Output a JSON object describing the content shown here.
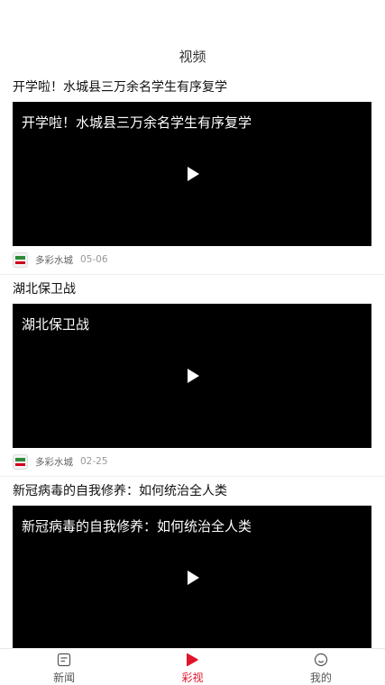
{
  "header": {
    "title": "视频"
  },
  "feed": [
    {
      "title": "开学啦！水城县三万余名学生有序复学",
      "caption": "开学啦！水城县三万余名学生有序复学",
      "source": "多彩水城",
      "date": "05-06"
    },
    {
      "title": "湖北保卫战",
      "caption": "湖北保卫战",
      "source": "多彩水城",
      "date": "02-25"
    },
    {
      "title": "新冠病毒的自我修养：如何统治全人类",
      "caption": "新冠病毒的自我修养：如何统治全人类",
      "source": "",
      "date": ""
    }
  ],
  "tabbar": {
    "tabs": [
      {
        "label": "新闻",
        "icon": "news-icon"
      },
      {
        "label": "彩视",
        "icon": "play-icon",
        "active": true
      },
      {
        "label": "我的",
        "icon": "smile-icon"
      }
    ]
  },
  "colors": {
    "accent": "#e0142a",
    "video_bg": "#000000"
  }
}
